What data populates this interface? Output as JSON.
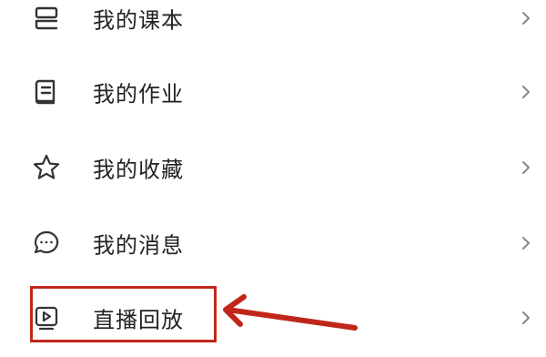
{
  "menu": {
    "items": [
      {
        "label": "我的课本",
        "icon": "textbook-icon"
      },
      {
        "label": "我的作业",
        "icon": "homework-icon"
      },
      {
        "label": "我的收藏",
        "icon": "star-icon"
      },
      {
        "label": "我的消息",
        "icon": "message-icon"
      },
      {
        "label": "直播回放",
        "icon": "play-icon"
      }
    ],
    "chevron_icon": "chevron-right-icon"
  },
  "annotation": {
    "highlight_color": "#c0271a",
    "target": "直播回放",
    "pointer_icon": "arrow-left-icon"
  },
  "colors": {
    "text": "#222222",
    "icon": "#333333",
    "chevron": "#888888"
  }
}
